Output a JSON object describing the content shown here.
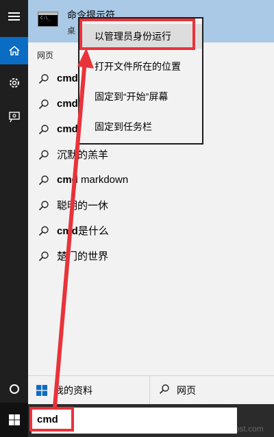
{
  "start_menu": {
    "best_match": {
      "title": "命令提示符",
      "subtitle": "桌"
    },
    "section_label": "网页",
    "results": [
      {
        "bold": "cmd",
        "rest": ""
      },
      {
        "bold": "cmd",
        "rest": ""
      },
      {
        "bold": "cmd",
        "rest": ""
      },
      {
        "bold": "",
        "rest": "沉默的羔羊"
      },
      {
        "bold": "cmd",
        "rest": " markdown"
      },
      {
        "bold": "",
        "rest": "聪明的一休"
      },
      {
        "bold": "cmd",
        "rest": "是什么"
      },
      {
        "bold": "",
        "rest": "楚门的世界"
      }
    ],
    "filters": {
      "mine": "我的资料",
      "web": "网页"
    }
  },
  "context_menu": {
    "items": [
      "以管理员身份运行",
      "打开文件所在的位置",
      "固定到“开始”屏幕",
      "固定到任务栏"
    ]
  },
  "taskbar": {
    "search_value": "cmd"
  },
  "watermark": {
    "main": "大地系统",
    "sub": "DadiGhost.com"
  },
  "colors": {
    "accent": "#0b6cc4",
    "annotation": "#e8333a",
    "best_match_bg": "#a9c9e6"
  }
}
